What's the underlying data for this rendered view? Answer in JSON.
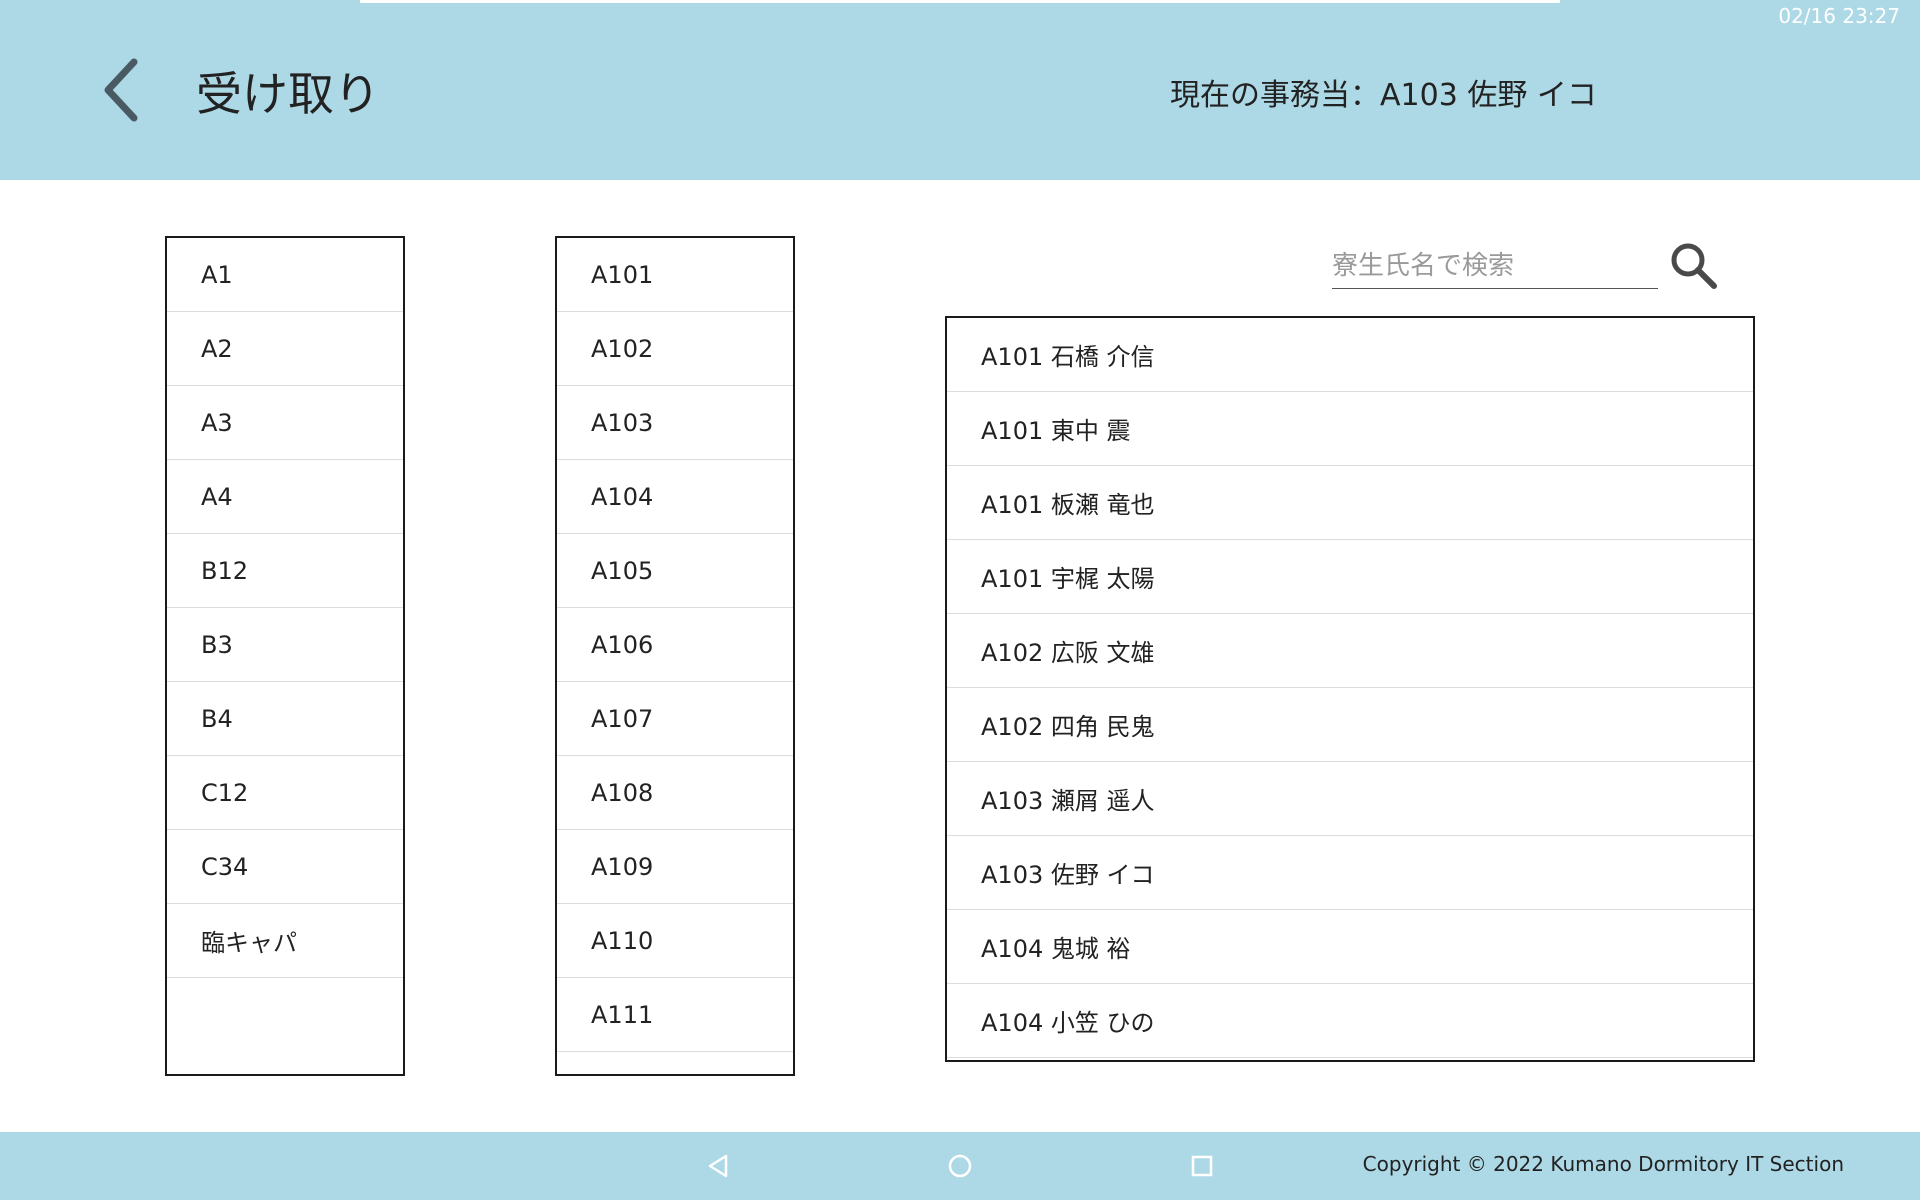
{
  "status_bar": {
    "time": "02/16 23:27"
  },
  "header": {
    "title": "受け取り",
    "current_officer": "現在の事務当：A103 佐野 イコ"
  },
  "blocks": [
    "A1",
    "A2",
    "A3",
    "A4",
    "B12",
    "B3",
    "B4",
    "C12",
    "C34",
    "臨キャパ"
  ],
  "rooms": [
    "A101",
    "A102",
    "A103",
    "A104",
    "A105",
    "A106",
    "A107",
    "A108",
    "A109",
    "A110",
    "A111"
  ],
  "search": {
    "placeholder": "寮生氏名で検索"
  },
  "residents": [
    "A101 石橋 介信",
    "A101 東中 震",
    "A101 板瀬 竜也",
    "A101 宇梶 太陽",
    "A102 広阪 文雄",
    "A102 四角 民鬼",
    "A103 瀬屑 遥人",
    "A103 佐野 イコ",
    "A104 鬼城 裕",
    "A104 小笠 ひの"
  ],
  "footer": {
    "copyright": "Copyright © 2022 Kumano Dormitory IT Section"
  },
  "colors": {
    "header_bg": "#add8e6",
    "footer_bg": "#add8e6",
    "border": "#1a1a1a"
  },
  "icons": {
    "back": "chevron-left-icon",
    "search": "search-icon",
    "nav_back": "triangle-back-icon",
    "nav_home": "circle-home-icon",
    "nav_recent": "square-recent-icon"
  }
}
